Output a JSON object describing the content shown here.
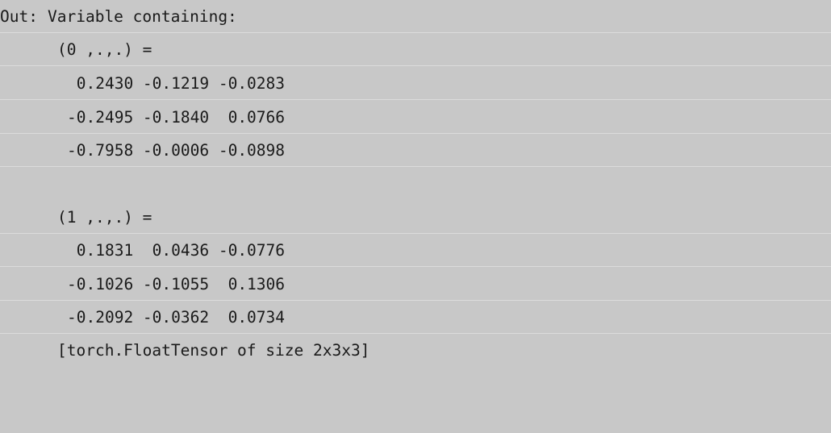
{
  "output": {
    "prefix": "Out:",
    "header": "Variable containing:",
    "slices": [
      {
        "label": "(0 ,.,.) =",
        "rows": [
          " 0.2430 -0.1219 -0.0283",
          "-0.2495 -0.1840  0.0766",
          "-0.7958 -0.0006 -0.0898"
        ]
      },
      {
        "label": "(1 ,.,.) =",
        "rows": [
          " 0.1831  0.0436 -0.0776",
          "-0.1026 -0.1055  0.1306",
          "-0.2092 -0.0362  0.0734"
        ]
      }
    ],
    "footer": "[torch.FloatTensor of size 2x3x3]"
  }
}
